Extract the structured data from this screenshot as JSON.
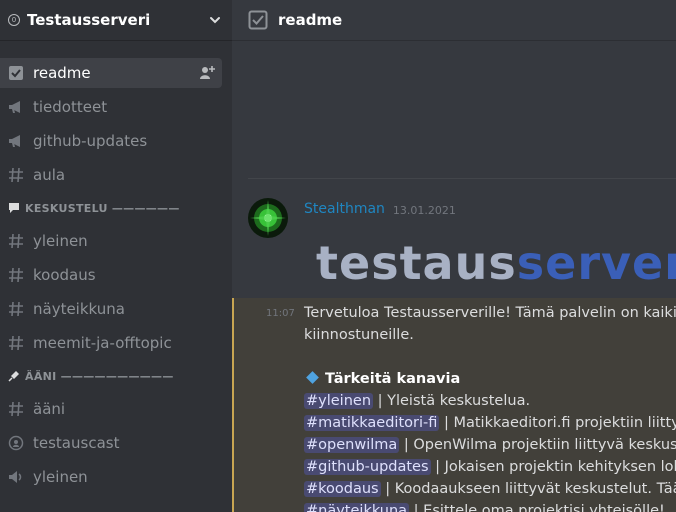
{
  "server": {
    "name": "Testausserveri",
    "badge": "0"
  },
  "channels_top": [
    {
      "label": "readme",
      "icon": "rules-icon",
      "active": true
    },
    {
      "label": "tiedotteet",
      "icon": "announcement-icon"
    },
    {
      "label": "github-updates",
      "icon": "announcement-icon"
    },
    {
      "label": "aula",
      "icon": "hash-icon"
    }
  ],
  "category_chat": {
    "label": "KESKUSTELU ——————"
  },
  "channels_chat": [
    {
      "label": "yleinen"
    },
    {
      "label": "koodaus"
    },
    {
      "label": "näyteikkuna"
    },
    {
      "label": "meemit-ja-offtopic"
    }
  ],
  "category_voice": {
    "label": "ÄÄNI ——————————"
  },
  "channels_voice": [
    {
      "label": "ääni",
      "icon": "hash-icon"
    },
    {
      "label": "testauscast",
      "icon": "stage-icon"
    },
    {
      "label": "yleinen",
      "icon": "speaker-icon"
    }
  ],
  "topbar": {
    "title": "readme"
  },
  "message": {
    "author": "Stealthman",
    "timestamp": "13.01.2021",
    "banner_part1": "testaus",
    "banner_part2": "server",
    "time": "11:07",
    "intro1": "Tervetuloa Testausserverille! Tämä palvelin on kaikille p",
    "intro2": "kiinnostuneille.",
    "heading": "Tärkeitä kanavia",
    "rows": [
      {
        "mention": "#yleinen",
        "text": " | Yleistä keskustelua."
      },
      {
        "mention": "#matikkaeditori-fi",
        "text": " | Matikkaeditori.fi projektiin liittyvä k"
      },
      {
        "mention": "#openwilma",
        "text": " | OpenWilma projektiin liittyvä keskustelu."
      },
      {
        "mention": "#github-updates",
        "text": " | Jokaisen projektin kehityksen loki."
      },
      {
        "mention": "#koodaus",
        "text": " | Koodaaukseen liittyvät keskustelut. Täällä sa"
      },
      {
        "mention": "#näyteikkuna",
        "text": " | Esittele oma projektisi yhteisölle!"
      }
    ]
  },
  "colors": {
    "sidebar": "#2f3136",
    "main": "#36393f",
    "highlight": "#42403a",
    "accent": "#c8a652"
  }
}
